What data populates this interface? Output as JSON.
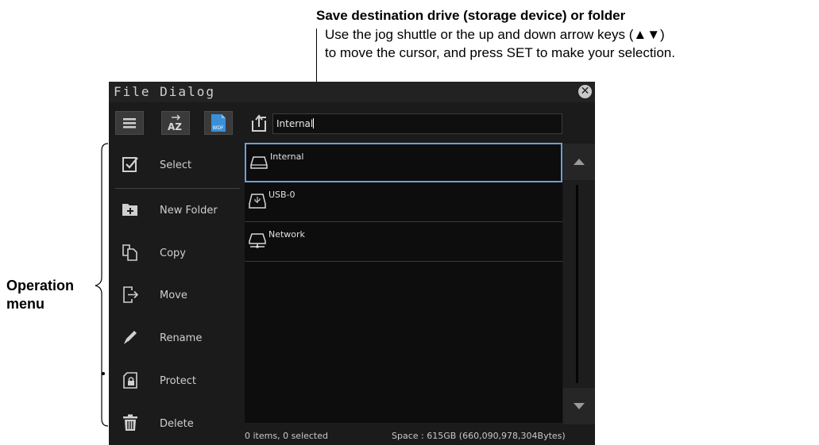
{
  "annotations": {
    "destination_title": "Save destination drive (storage device) or folder",
    "destination_line1": "Use the jog shuttle or the up and down arrow keys (▲▼)",
    "destination_line2": "to move the cursor, and press SET to make your selection.",
    "operation_line1": "Operation",
    "operation_line2": "menu"
  },
  "dialog": {
    "title": "File Dialog",
    "close_icon": "close-icon",
    "toolbar": {
      "buttons": [
        {
          "icon": "list-view-icon"
        },
        {
          "icon": "sort-az-icon",
          "text": "AZ"
        },
        {
          "icon": "file-type-wdf-icon",
          "text": "WDF"
        }
      ],
      "path_icon": "folder-up-icon",
      "path_value": "Internal"
    },
    "menu": [
      {
        "label": "Select",
        "icon": "checkbox-icon"
      },
      {
        "label": "New Folder",
        "icon": "new-folder-icon"
      },
      {
        "label": "Copy",
        "icon": "copy-icon"
      },
      {
        "label": "Move",
        "icon": "move-icon"
      },
      {
        "label": "Rename",
        "icon": "pencil-icon"
      },
      {
        "label": "Protect",
        "icon": "lock-icon"
      },
      {
        "label": "Delete",
        "icon": "trash-icon"
      }
    ],
    "drives": [
      {
        "name": "Internal",
        "icon": "internal-drive-icon",
        "selected": true
      },
      {
        "name": "USB-0",
        "icon": "usb-drive-icon",
        "selected": false
      },
      {
        "name": "Network",
        "icon": "network-drive-icon",
        "selected": false
      }
    ],
    "status": {
      "items": "0 items, 0 selected",
      "space": "Space : 615GB (660,090,978,304Bytes)"
    },
    "colors": {
      "background": "#1b1b1b",
      "selection_border": "#6d9fd6",
      "wdf_icon": "#3a8fd8"
    }
  }
}
